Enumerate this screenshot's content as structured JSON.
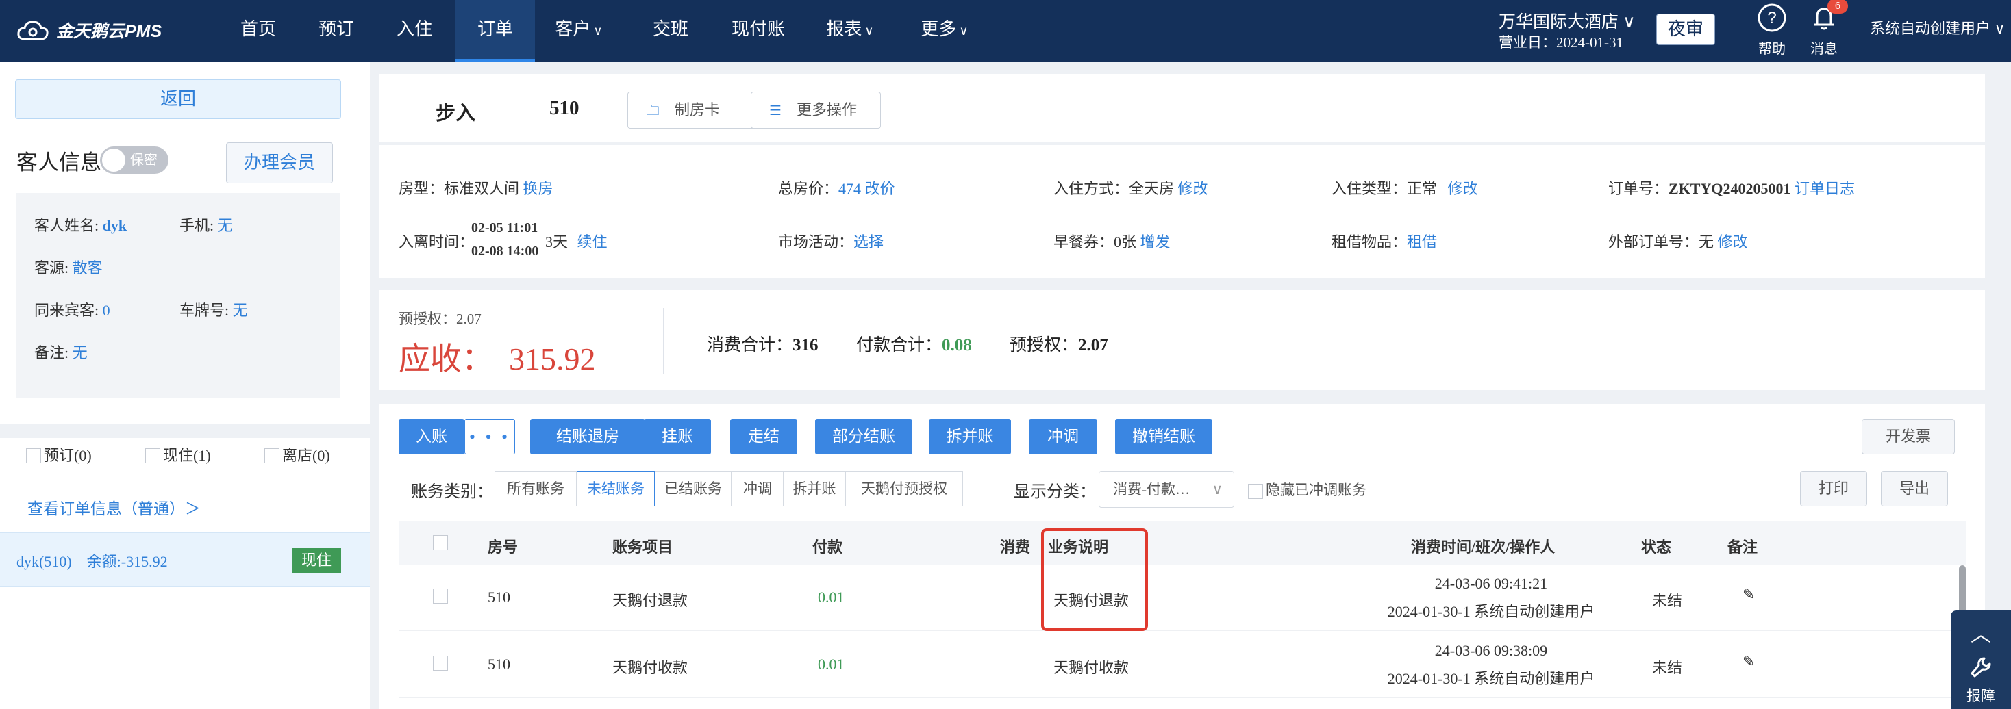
{
  "brand": {
    "name": "金天鹅云PMS"
  },
  "nav": {
    "items": [
      {
        "label": "首页",
        "caret": ""
      },
      {
        "label": "预订",
        "caret": ""
      },
      {
        "label": "入住",
        "caret": ""
      },
      {
        "label": "订单",
        "caret": ""
      },
      {
        "label": "客户",
        "caret": "∨"
      },
      {
        "label": "交班",
        "caret": ""
      },
      {
        "label": "现付账",
        "caret": ""
      },
      {
        "label": "报表",
        "caret": "∨"
      },
      {
        "label": "更多",
        "caret": "∨"
      }
    ],
    "active": "订单"
  },
  "header": {
    "hotel": "万华国际大酒店 ∨",
    "business_date": "营业日：2024-01-31",
    "night_audit": "夜审",
    "help": "帮助",
    "messages": "消息",
    "message_count": "6",
    "user": "系统自动创建用户 ∨"
  },
  "sidebar": {
    "back": "返回",
    "guest_title": "客人信息",
    "privacy": "保密",
    "member_btn": "办理会员",
    "fields": {
      "name_label": "客人姓名:",
      "name_value": "dyk",
      "phone_label": "手机:",
      "phone_value": "无",
      "source_label": "客源:",
      "source_value": "散客",
      "companions_label": "同来宾客:",
      "companions_value": "0",
      "plate_label": "车牌号:",
      "plate_value": "无",
      "remark_label": "备注:",
      "remark_value": "无"
    },
    "status": {
      "reserved": "预订(0)",
      "in_house": "现住(1)",
      "departed": "离店(0)"
    },
    "order_link": "查看订单信息（普通）＞",
    "room_item": {
      "label": "dyk(510)    余额:-315.92",
      "tag": "现住"
    }
  },
  "order": {
    "type": "步入",
    "room": "510",
    "make_card": "制房卡",
    "more_ops": "更多操作"
  },
  "details": {
    "room_type_label": "房型：",
    "room_type": "标准双人间",
    "change_room": "换房",
    "total_label": "总房价：",
    "total": "474",
    "change_price": "改价",
    "checkin_mode_label": "入住方式：",
    "checkin_mode": "全天房",
    "edit1": "修改",
    "checkin_type_label": "入住类型：",
    "checkin_type": "正常",
    "edit2": "修改",
    "order_no_label": "订单号：",
    "order_no": "ZKTYQ240205001",
    "order_log": "订单日志",
    "stay_label": "入离时间：",
    "arrive": "02-05 11:01",
    "depart": "02-08 14:00",
    "nights": "3天",
    "extend": "续住",
    "market_label": "市场活动：",
    "market": "选择",
    "breakfast_label": "早餐券：",
    "breakfast": "0张",
    "breakfast_add": "增发",
    "rental_label": "租借物品：",
    "rental": "租借",
    "ext_order_label": "外部订单号：",
    "ext_order": "无",
    "edit3": "修改"
  },
  "summary": {
    "preauth_small": "预授权：2.07",
    "receivable": "应收：  315.92",
    "consumption_label": "消费合计：",
    "consumption": "316",
    "payment_label": "付款合计：",
    "payment": "0.08",
    "preauth_label": "预授权：",
    "preauth": "2.07"
  },
  "actions": {
    "checkin": "入账",
    "more": "• • •",
    "checkout": "结账退房",
    "hang": "挂账",
    "walk": "走结",
    "partial": "部分结账",
    "split": "拆并账",
    "adjust": "冲调",
    "cancel": "撤销结账",
    "invoice": "开发票",
    "print": "打印",
    "export": "导出"
  },
  "filters": {
    "label": "账务类别：",
    "options": [
      "所有账务",
      "未结账务",
      "已结账务",
      "冲调",
      "拆并账",
      "天鹅付预授权"
    ],
    "active": "未结账务",
    "display_label": "显示分类：",
    "display_value": "消费-付款…",
    "hide_adjusted": "隐藏已冲调账务"
  },
  "table": {
    "headers": [
      "房号",
      "账务项目",
      "付款",
      "消费",
      "业务说明",
      "消费时间/班次/操作人",
      "状态",
      "备注"
    ],
    "rows": [
      {
        "room": "510",
        "item": "天鹅付退款",
        "payment": "0.01",
        "consumption": "",
        "desc": "天鹅付退款",
        "time": "24-03-06 09:41:21",
        "shift": "2024-01-30-1 系统自动创建用户",
        "status": "未结"
      },
      {
        "room": "510",
        "item": "天鹅付收款",
        "payment": "0.01",
        "consumption": "",
        "desc": "天鹅付收款",
        "time": "24-03-06 09:38:09",
        "shift": "2024-01-30-1 系统自动创建用户",
        "status": "未结"
      }
    ]
  },
  "float": {
    "report": "报障"
  }
}
